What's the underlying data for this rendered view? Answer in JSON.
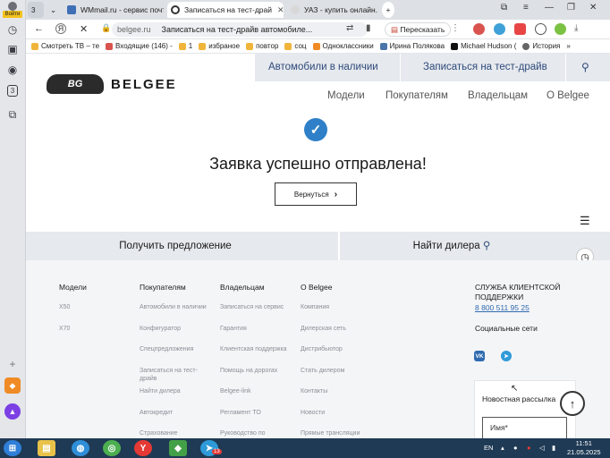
{
  "sidebar": {
    "avatar_label": "Войти",
    "icons": [
      "history-icon",
      "video-icon",
      "play-icon",
      "badge-3-icon",
      "collections-icon",
      "add-icon",
      "bag-icon",
      "alice-icon"
    ],
    "badge_text": "3"
  },
  "tabs": [
    {
      "title": "WMmail.ru - сервис почтс",
      "active": false,
      "favicon_color": "#3f6fb5"
    },
    {
      "title": "Записаться на тест-драй",
      "active": true,
      "favicon_color": "#333333"
    },
    {
      "title": "УАЗ - купить онлайн.",
      "active": false,
      "favicon_color": "#d8d8d8"
    }
  ],
  "tab_counter": "3",
  "addressbar": {
    "domain": "belgee.ru",
    "page_title": "Записаться на тест-драйв автомобиле...",
    "retell_label": "Пересказать"
  },
  "bookmarks": [
    {
      "label": "Смотреть ТВ – те",
      "color": "#f0b43a"
    },
    {
      "label": "Входящие (146) -",
      "color": "#d9534f"
    },
    {
      "label": "1",
      "color": "#f0b43a"
    },
    {
      "label": "избраное",
      "color": "#f0b43a"
    },
    {
      "label": "повтор",
      "color": "#f0b43a"
    },
    {
      "label": "соц",
      "color": "#f0b43a"
    },
    {
      "label": "Одноклассники",
      "color": "#f08a24"
    },
    {
      "label": "Ирина Полякова",
      "color": "#4a76a8"
    },
    {
      "label": "Michael Hudson (",
      "color": "#111111"
    },
    {
      "label": "История",
      "color": "#666666"
    }
  ],
  "site": {
    "topnav": {
      "cars_in_stock": "Автомобили в наличии",
      "test_drive": "Записаться на тест-драйв"
    },
    "logo_badge": "BG",
    "logo_text": "BELGEE",
    "mainnav": {
      "models": "Модели",
      "buyers": "Покупателям",
      "owners": "Владельцам",
      "about": "О Belgee"
    },
    "success_message": "Заявка успешно отправлена!",
    "back_button": "Вернуться",
    "cta": {
      "get_offer": "Получить предложение",
      "find_dealer": "Найти дилера"
    },
    "footer": {
      "columns": [
        {
          "heading": "Модели",
          "links": [
            "X50",
            "X70"
          ]
        },
        {
          "heading": "Покупателям",
          "links": [
            "Автомобили в наличии",
            "Конфигуратор",
            "Спецпредложения",
            "Записаться на тест-драйв",
            "Найти дилера",
            "Автокредит",
            "Страхование"
          ]
        },
        {
          "heading": "Владельцам",
          "links": [
            "Записаться на сервис",
            "Гарантия",
            "Клиентская поддержка",
            "Помощь на дорогах",
            "Belgee-link",
            "Регламент ТО",
            "Руководство по"
          ]
        },
        {
          "heading": "О Belgee",
          "links": [
            "Компания",
            "Дилерская сеть",
            "Дистрибьютор",
            "Стать дилером",
            "Контакты",
            "Новости",
            "Прямые трансляции"
          ]
        }
      ],
      "support_heading": "СЛУЖБА КЛИЕНТСКОЙ ПОДДЕРЖКИ",
      "phone": "8 800 511 95 25",
      "social_heading": "Социальные сети",
      "vk_label": "VK",
      "newsletter_title": "Новостная рассылка",
      "name_placeholder": "Имя*"
    }
  },
  "taskbar": {
    "lang": "EN",
    "time": "11:51",
    "date": "21.05.2025",
    "telegram_badge": "13"
  }
}
